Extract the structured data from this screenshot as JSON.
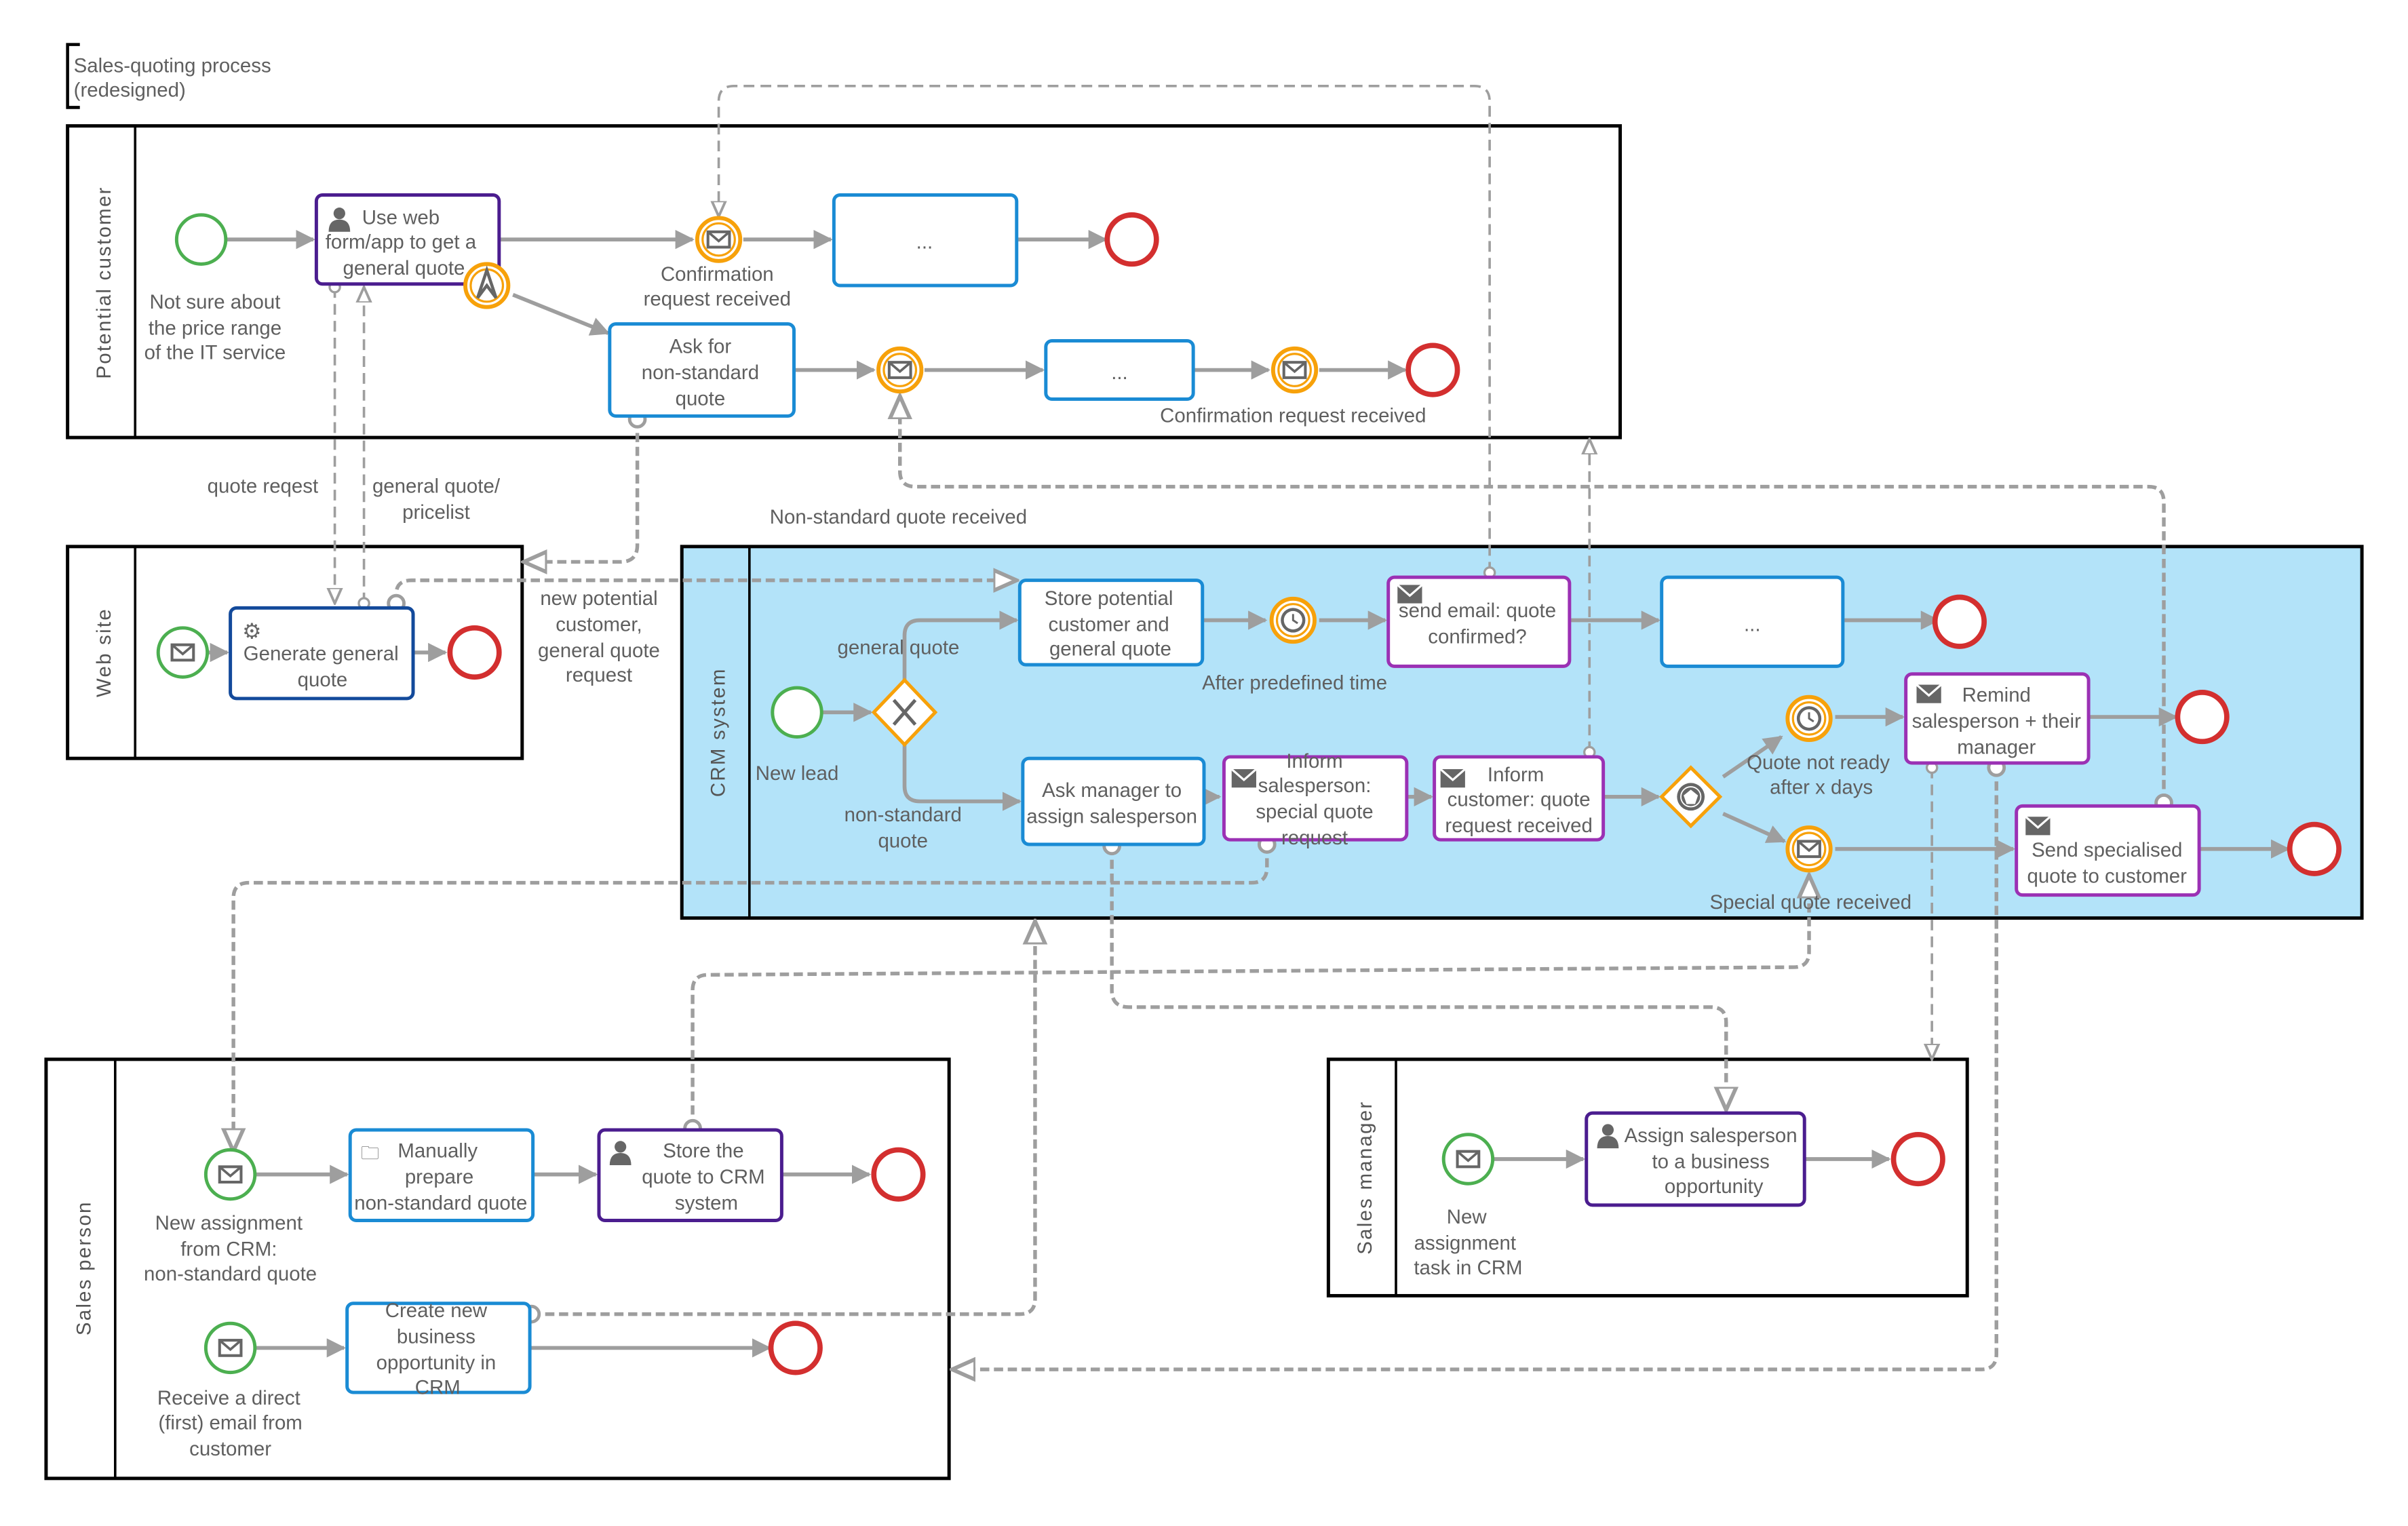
{
  "diagram": {
    "title_line1": "Sales-quoting process",
    "title_line2": "(redesigned)",
    "pools": {
      "potential_customer": "Potential customer",
      "web_site": "Web site",
      "crm_system": "CRM system",
      "sales_person": "Sales person",
      "sales_manager": "Sales manager"
    },
    "potential_customer": {
      "start_label": [
        "Not sure about",
        "the price range",
        "of the IT service"
      ],
      "task_use_web": [
        "Use web",
        "form/app to get a",
        "general quote"
      ],
      "event_confirmation_1": [
        "Confirmation",
        "request received"
      ],
      "task_placeholder": "...",
      "task_ask_nonstandard": [
        "Ask for",
        "non-standard",
        "quote"
      ],
      "task_placeholder_2": "...",
      "event_confirmation_2": "Confirmation request received"
    },
    "web_site": {
      "task_generate": [
        "Generate general",
        "quote"
      ]
    },
    "crm_system": {
      "start_label": "New lead",
      "branch_general": "general quote",
      "branch_nonstandard": [
        "non-standard",
        "quote"
      ],
      "task_store": [
        "Store potential",
        "customer and",
        "general quote"
      ],
      "timer_label": "After predefined time",
      "task_send_email": [
        "send email: quote",
        "confirmed?"
      ],
      "task_placeholder": "...",
      "task_ask_manager": [
        "Ask manager to",
        "assign salesperson"
      ],
      "task_inform_salesperson": [
        "Inform",
        "salesperson:",
        "special quote",
        "request"
      ],
      "task_inform_customer": [
        "Inform",
        "customer: quote",
        "request received"
      ],
      "timer2_label": [
        "Quote not ready",
        "after x days"
      ],
      "msg_event_label": "Special quote received",
      "task_remind": [
        "Remind",
        "salesperson + their",
        "manager"
      ],
      "task_send_specialised": [
        "Send specialised",
        "quote to customer"
      ]
    },
    "sales_person": {
      "start1_label": [
        "New assignment",
        "from CRM:",
        "non-standard quote"
      ],
      "task_manual": [
        "Manually",
        "prepare",
        "non-standard quote"
      ],
      "task_store_crm": [
        "Store the",
        "quote to CRM",
        "system"
      ],
      "start2_label": [
        "Receive a direct",
        "(first) email from",
        "customer"
      ],
      "task_create_opportunity": [
        "Create new",
        "business",
        "opportunity in",
        "CRM"
      ]
    },
    "sales_manager": {
      "start_label": [
        "New",
        "assignment",
        "task in CRM"
      ],
      "task_assign": [
        "Assign salesperson",
        "to a business",
        "opportunity"
      ]
    },
    "message_flow_labels": {
      "quote_request": "quote reqest",
      "general_quote_pricelist": [
        "general quote/",
        "pricelist"
      ],
      "nonstandard_received": "Non-standard quote received",
      "new_potential_customer": [
        "new potential",
        "customer,",
        "general quote",
        "request"
      ]
    }
  }
}
